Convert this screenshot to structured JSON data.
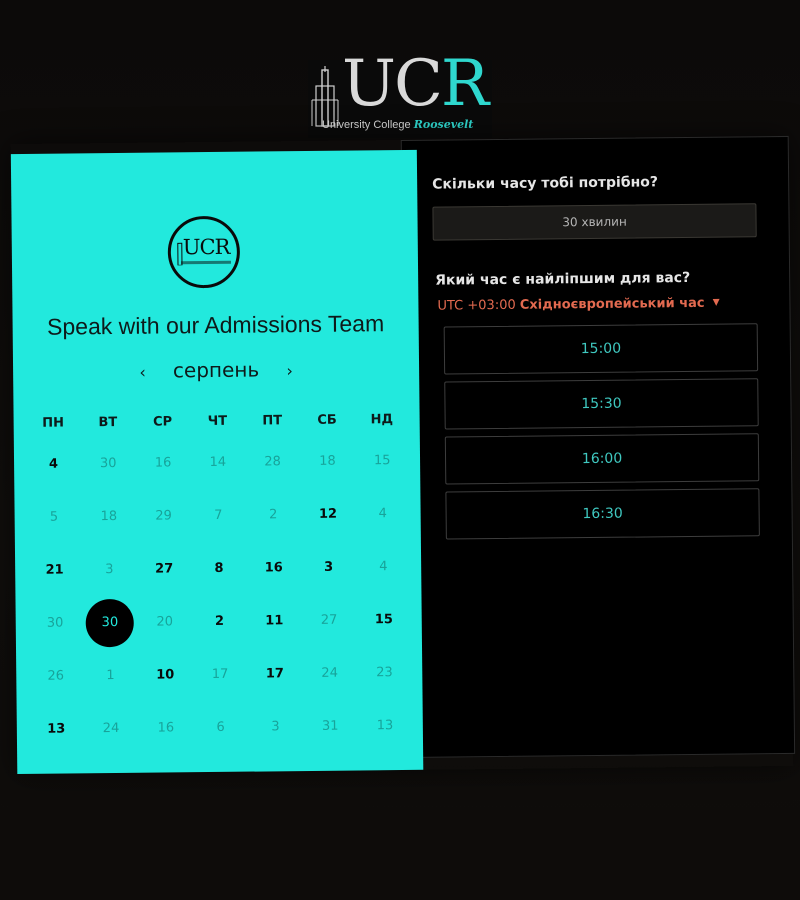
{
  "logo": {
    "letters_uc": "UC",
    "letters_r": "R",
    "tagline_main": "University College",
    "tagline_accent": "Roosevelt"
  },
  "left_panel": {
    "small_logo_text": "UCR",
    "title": "Speak with our Admissions Team",
    "month": "серпень",
    "prev_icon": "‹",
    "next_icon": "›",
    "weekdays": [
      "ПН",
      "ВТ",
      "СР",
      "ЧТ",
      "ПТ",
      "СБ",
      "НД"
    ],
    "days": [
      {
        "d": "4",
        "on": true
      },
      {
        "d": "30",
        "on": false
      },
      {
        "d": "16",
        "on": false
      },
      {
        "d": "14",
        "on": false
      },
      {
        "d": "28",
        "on": false
      },
      {
        "d": "18",
        "on": false
      },
      {
        "d": "15",
        "on": false
      },
      {
        "d": "5",
        "on": false
      },
      {
        "d": "18",
        "on": false
      },
      {
        "d": "29",
        "on": false
      },
      {
        "d": "7",
        "on": false
      },
      {
        "d": "2",
        "on": false
      },
      {
        "d": "12",
        "on": true
      },
      {
        "d": "4",
        "on": false
      },
      {
        "d": "21",
        "on": true
      },
      {
        "d": "3",
        "on": false
      },
      {
        "d": "27",
        "on": true
      },
      {
        "d": "8",
        "on": true
      },
      {
        "d": "16",
        "on": true
      },
      {
        "d": "3",
        "on": true
      },
      {
        "d": "4",
        "on": false
      },
      {
        "d": "30",
        "on": false
      },
      {
        "d": "30",
        "on": true,
        "selected": true
      },
      {
        "d": "20",
        "on": false
      },
      {
        "d": "2",
        "on": true
      },
      {
        "d": "11",
        "on": true
      },
      {
        "d": "27",
        "on": false
      },
      {
        "d": "15",
        "on": true
      },
      {
        "d": "26",
        "on": false
      },
      {
        "d": "1",
        "on": false
      },
      {
        "d": "10",
        "on": true
      },
      {
        "d": "17",
        "on": false
      },
      {
        "d": "17",
        "on": true
      },
      {
        "d": "24",
        "on": false
      },
      {
        "d": "23",
        "on": false
      },
      {
        "d": "13",
        "on": true
      },
      {
        "d": "24",
        "on": false
      },
      {
        "d": "16",
        "on": false
      },
      {
        "d": "6",
        "on": false
      },
      {
        "d": "3",
        "on": false
      },
      {
        "d": "31",
        "on": false
      },
      {
        "d": "13",
        "on": false
      }
    ]
  },
  "right_panel": {
    "duration_question": "Скільки часу тобі потрібно?",
    "duration_value": "30 хвилин",
    "time_question": "Який час є найліпшим для вас?",
    "timezone_offset": "UTC +03:00",
    "timezone_name": "Східноєвропейський час",
    "timezone_caret": "▼",
    "slots": [
      "15:00",
      "15:30",
      "16:00",
      "16:30"
    ]
  },
  "colors": {
    "accent_cyan": "#22e9dd",
    "slot_text": "#3fc8c0",
    "timezone_orange": "#e36a50",
    "panel_dark": "#000000"
  }
}
